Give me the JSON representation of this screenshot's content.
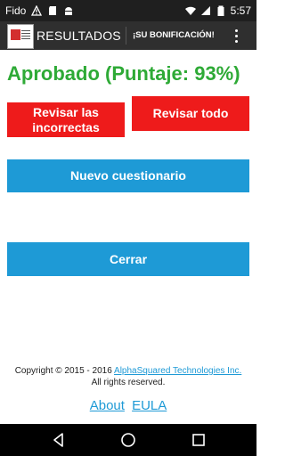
{
  "status_bar": {
    "carrier": "Fido",
    "time": "5:57",
    "left_icons": [
      "warning-icon",
      "sd-card-icon",
      "android-icon"
    ],
    "right_icons": [
      "wifi-icon",
      "signal-icon",
      "battery-icon"
    ]
  },
  "app_bar": {
    "title": "RESULTADOS",
    "bonus_label": "¡SU BONIFICACIÓN!",
    "logo_icon": "app-logo",
    "menu_icon": "overflow-menu-icon"
  },
  "result": {
    "text": "Aprobado (Puntaje: 93%)",
    "color": "#2eaa36"
  },
  "buttons": {
    "review_incorrect_line1": "Revisar las",
    "review_incorrect_line2": "incorrectas",
    "review_all": "Revisar todo",
    "new_quiz": "Nuevo cuestionario",
    "close": "Cerrar",
    "red_color": "#ee1b1b",
    "blue_color": "#1e9ad6"
  },
  "footer": {
    "copyright_prefix": "Copyright © 2015 - 2016",
    "company": "AlphaSquared Technologies Inc.",
    "rights": "All rights reserved.",
    "about": "About",
    "eula": "EULA"
  },
  "nav_bar": {
    "icons": [
      "back-icon",
      "home-icon",
      "recents-icon"
    ]
  }
}
